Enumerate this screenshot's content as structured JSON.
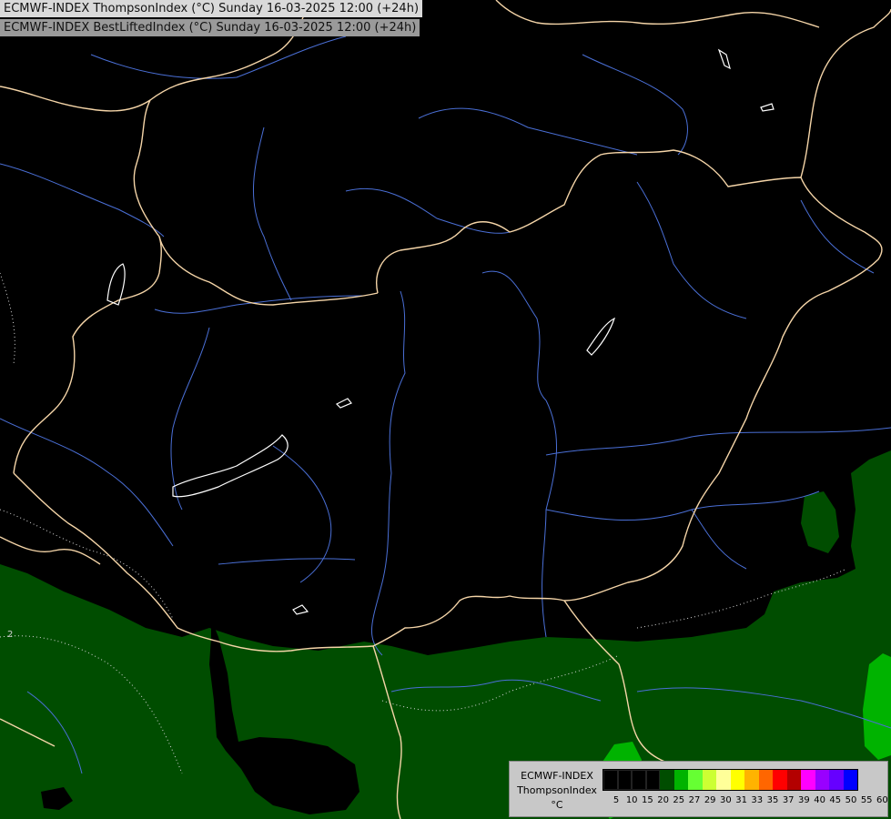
{
  "titles": {
    "line1": "ECMWF-INDEX ThompsonIndex (°C) Sunday 16-03-2025 12:00 (+24h)",
    "line2": "ECMWF-INDEX BestLiftedIndex (°C) Sunday 16-03-2025 12:00 (+24h)"
  },
  "contour_labels": [
    "2"
  ],
  "legend": {
    "label_lines": [
      "ECMWF-INDEX",
      "ThompsonIndex",
      "°C"
    ],
    "ticks": [
      "5",
      "10",
      "15",
      "20",
      "25",
      "27",
      "29",
      "30",
      "31",
      "33",
      "35",
      "37",
      "39",
      "40",
      "45",
      "50",
      "55",
      "60"
    ],
    "colors": [
      "#000000",
      "#000000",
      "#000000",
      "#000000",
      "#004d00",
      "#00b300",
      "#66ff33",
      "#ccff33",
      "#ffff99",
      "#ffff00",
      "#ffb300",
      "#ff6600",
      "#ff0000",
      "#b30000",
      "#ff00ff",
      "#9900ff",
      "#6600ff",
      "#0000ff"
    ]
  },
  "colors": {
    "background": "#000000",
    "field_green": "#004d00",
    "field_green_light": "#00b300",
    "borders": "#f5d5a8",
    "rivers": "#4a6fd6",
    "lakes": "#ffffff"
  }
}
